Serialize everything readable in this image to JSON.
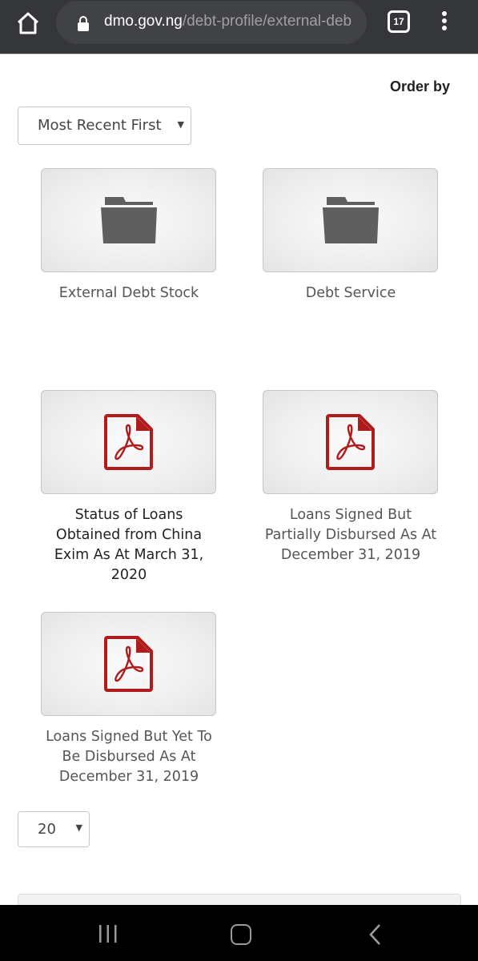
{
  "browser": {
    "url_domain": "dmo.gov.ng",
    "url_path": "/debt-profile/external-deb",
    "tab_count": "17",
    "icons": {
      "home": "home-icon",
      "lock": "lock-icon",
      "tabs": "tabs-icon",
      "menu": "more-vert-icon"
    }
  },
  "sort": {
    "label": "Order by",
    "selected": "Most Recent First"
  },
  "items": [
    {
      "type": "folder",
      "icon": "folder-icon",
      "title": "External Debt Stock"
    },
    {
      "type": "folder",
      "icon": "folder-icon",
      "title": "Debt Service"
    },
    {
      "type": "pdf",
      "icon": "pdf-icon",
      "title": "Status of Loans Obtained from China Exim As At March 31, 2020"
    },
    {
      "type": "pdf",
      "icon": "pdf-icon",
      "title": "Loans Signed But Partially Disbursed As At December 31, 2019"
    },
    {
      "type": "pdf",
      "icon": "pdf-icon",
      "title": "Loans Signed But Yet To Be Disbursed As At December 31, 2019"
    }
  ],
  "pagination": {
    "limit_selected": "20"
  },
  "colors": {
    "pdf_red": "#b01c1c",
    "folder_gray": "#5f5f5f",
    "browser_bar": "#35363a"
  },
  "system_nav": {
    "icons": {
      "recents": "recents-icon",
      "home": "home-nav-icon",
      "back": "back-icon"
    }
  }
}
